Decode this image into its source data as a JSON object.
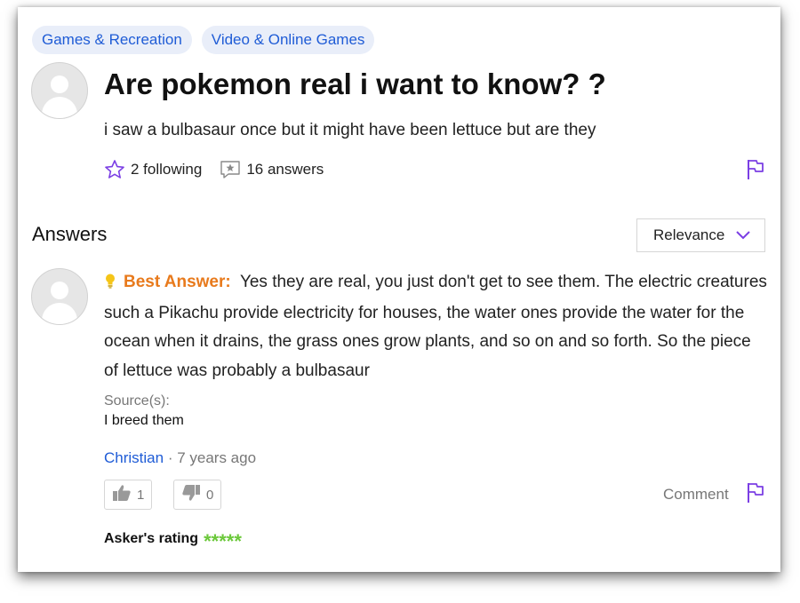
{
  "categories": [
    "Games & Recreation",
    "Video & Online Games"
  ],
  "question": {
    "title": "Are pokemon real i want to know? ?",
    "body": "i saw a bulbasaur once but it might have been lettuce but are they",
    "following": "2 following",
    "answers_count": "16 answers"
  },
  "answers_section": {
    "title": "Answers",
    "sort_label": "Relevance"
  },
  "best_answer": {
    "label": "Best Answer:",
    "text": "Yes they are real, you just don't get to see them. The electric creatures such a Pikachu provide electricity for houses, the water ones provide the water for the ocean when it drains, the grass ones grow plants, and so on and so forth. So the piece of lettuce was probably a bulbasaur",
    "sources_label": "Source(s):",
    "sources_value": "I breed them",
    "author": "Christian",
    "time": " · 7 years ago",
    "thumbs_up": "1",
    "thumbs_down": "0",
    "comment_label": "Comment",
    "rating_label": "Asker's rating",
    "rating_stars": "*****"
  },
  "colors": {
    "link": "#1f5cd6",
    "tag_bg": "#e9eef9",
    "accent_purple": "#7b3fe4",
    "best_answer": "#e87a1c",
    "stars": "#6bc83a"
  },
  "icons": [
    "star-outline-icon",
    "answers-icon",
    "flag-icon",
    "chevron-down-icon",
    "lightbulb-icon",
    "thumbs-up-icon",
    "thumbs-down-icon",
    "avatar-icon"
  ]
}
